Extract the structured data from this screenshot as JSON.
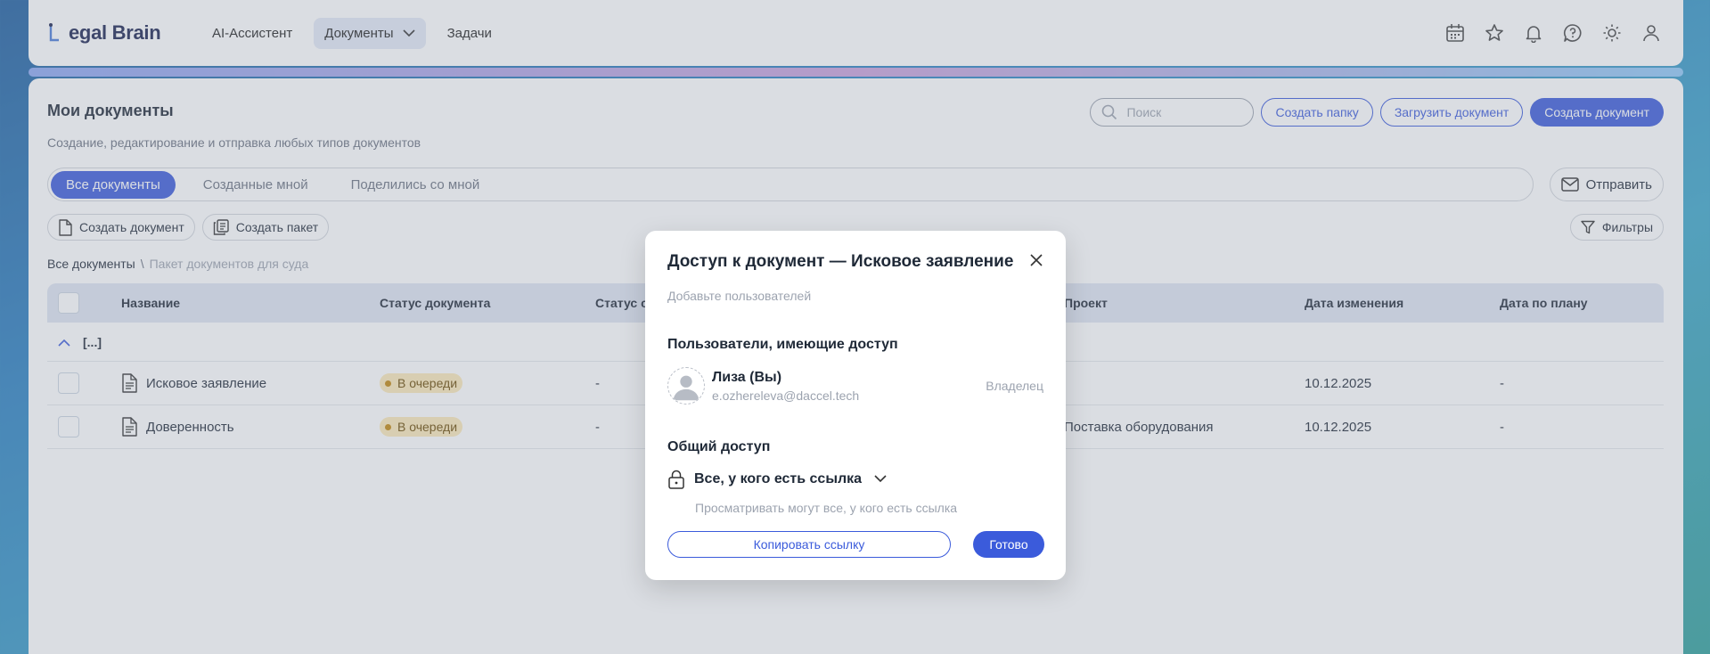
{
  "app": {
    "logo_text": "egal Brain",
    "nav": [
      {
        "label": "AI-Ассистент"
      },
      {
        "label": "Документы"
      },
      {
        "label": "Задачи"
      }
    ]
  },
  "page": {
    "title": "Мои документы",
    "subtitle": "Создание, редактирование и отправка любых типов документов",
    "search_placeholder": "Поиск",
    "create_folder": "Создать папку",
    "upload_document": "Загрузить документ",
    "create_document": "Создать документ",
    "tabs": [
      {
        "label": "Все документы"
      },
      {
        "label": "Созданные мной"
      },
      {
        "label": "Поделились со мной"
      }
    ],
    "send": "Отправить",
    "toolbar": {
      "create_document": "Создать документ",
      "create_package": "Создать пакет",
      "filters": "Фильтры"
    },
    "breadcrumb": {
      "root": "Все документы",
      "separator": "\\",
      "current": "Пакет документов для суда"
    }
  },
  "table": {
    "columns": [
      "Название",
      "Статус документа",
      "Статус с",
      "Проект",
      "Дата изменения",
      "Дата по плану"
    ],
    "group_label": "[...]",
    "rows": [
      {
        "name": "Исковое заявление",
        "status": "В очереди",
        "status2": "-",
        "project": "",
        "modified": "10.12.2025",
        "planned": "-"
      },
      {
        "name": "Доверенность",
        "status": "В очереди",
        "status2": "-",
        "project": "Поставка оборудования",
        "modified": "10.12.2025",
        "planned": "-"
      }
    ]
  },
  "modal": {
    "title": "Доступ к документ — Исковое заявление",
    "add_users": "Добавьте пользователей",
    "users_title": "Пользователи, имеющие доступ",
    "user": {
      "name": "Лиза (Вы)",
      "email": "e.ozhereleva@daccel.tech",
      "role": "Владелец"
    },
    "general_title": "Общий доступ",
    "access_option": "Все, у кого есть ссылка",
    "access_desc": "Просматривать могут все, у кого есть ссылка",
    "copy_link": "Копировать ссылку",
    "done": "Готово"
  },
  "colors": {
    "primary": "#3b5bdb",
    "badge_bg": "#fde9b8",
    "badge_dot": "#c2860d"
  }
}
